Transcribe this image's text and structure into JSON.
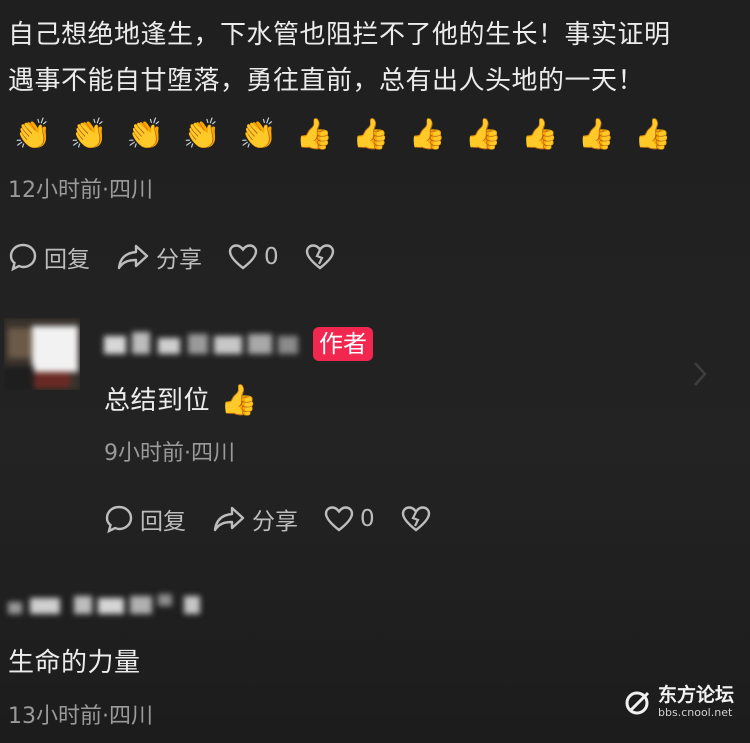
{
  "comment1": {
    "line1": "自己想绝地逢生，下水管也阻拦不了他的生长！事实证明",
    "line2": "遇事不能自甘堕落，勇往直前，总有出人头地的一天！",
    "emojis": [
      "👏",
      "👏",
      "👏",
      "👏",
      "👏",
      "👍",
      "👍",
      "👍",
      "👍",
      "👍",
      "👍",
      "👍"
    ],
    "meta": "12小时前·四川",
    "actions": {
      "reply": "回复",
      "share": "分享",
      "like_count": "0"
    }
  },
  "comment2": {
    "badge": "作者",
    "text": "总结到位",
    "emoji": "👍",
    "meta": "9小时前·四川",
    "actions": {
      "reply": "回复",
      "share": "分享",
      "like_count": "0"
    }
  },
  "comment3": {
    "text": "生命的力量",
    "meta": "13小时前·四川"
  },
  "watermark": {
    "name": "东方论坛",
    "url": "bbs.cnool.net"
  },
  "colors": {
    "badge": "#f2274f",
    "background": "#202020"
  }
}
